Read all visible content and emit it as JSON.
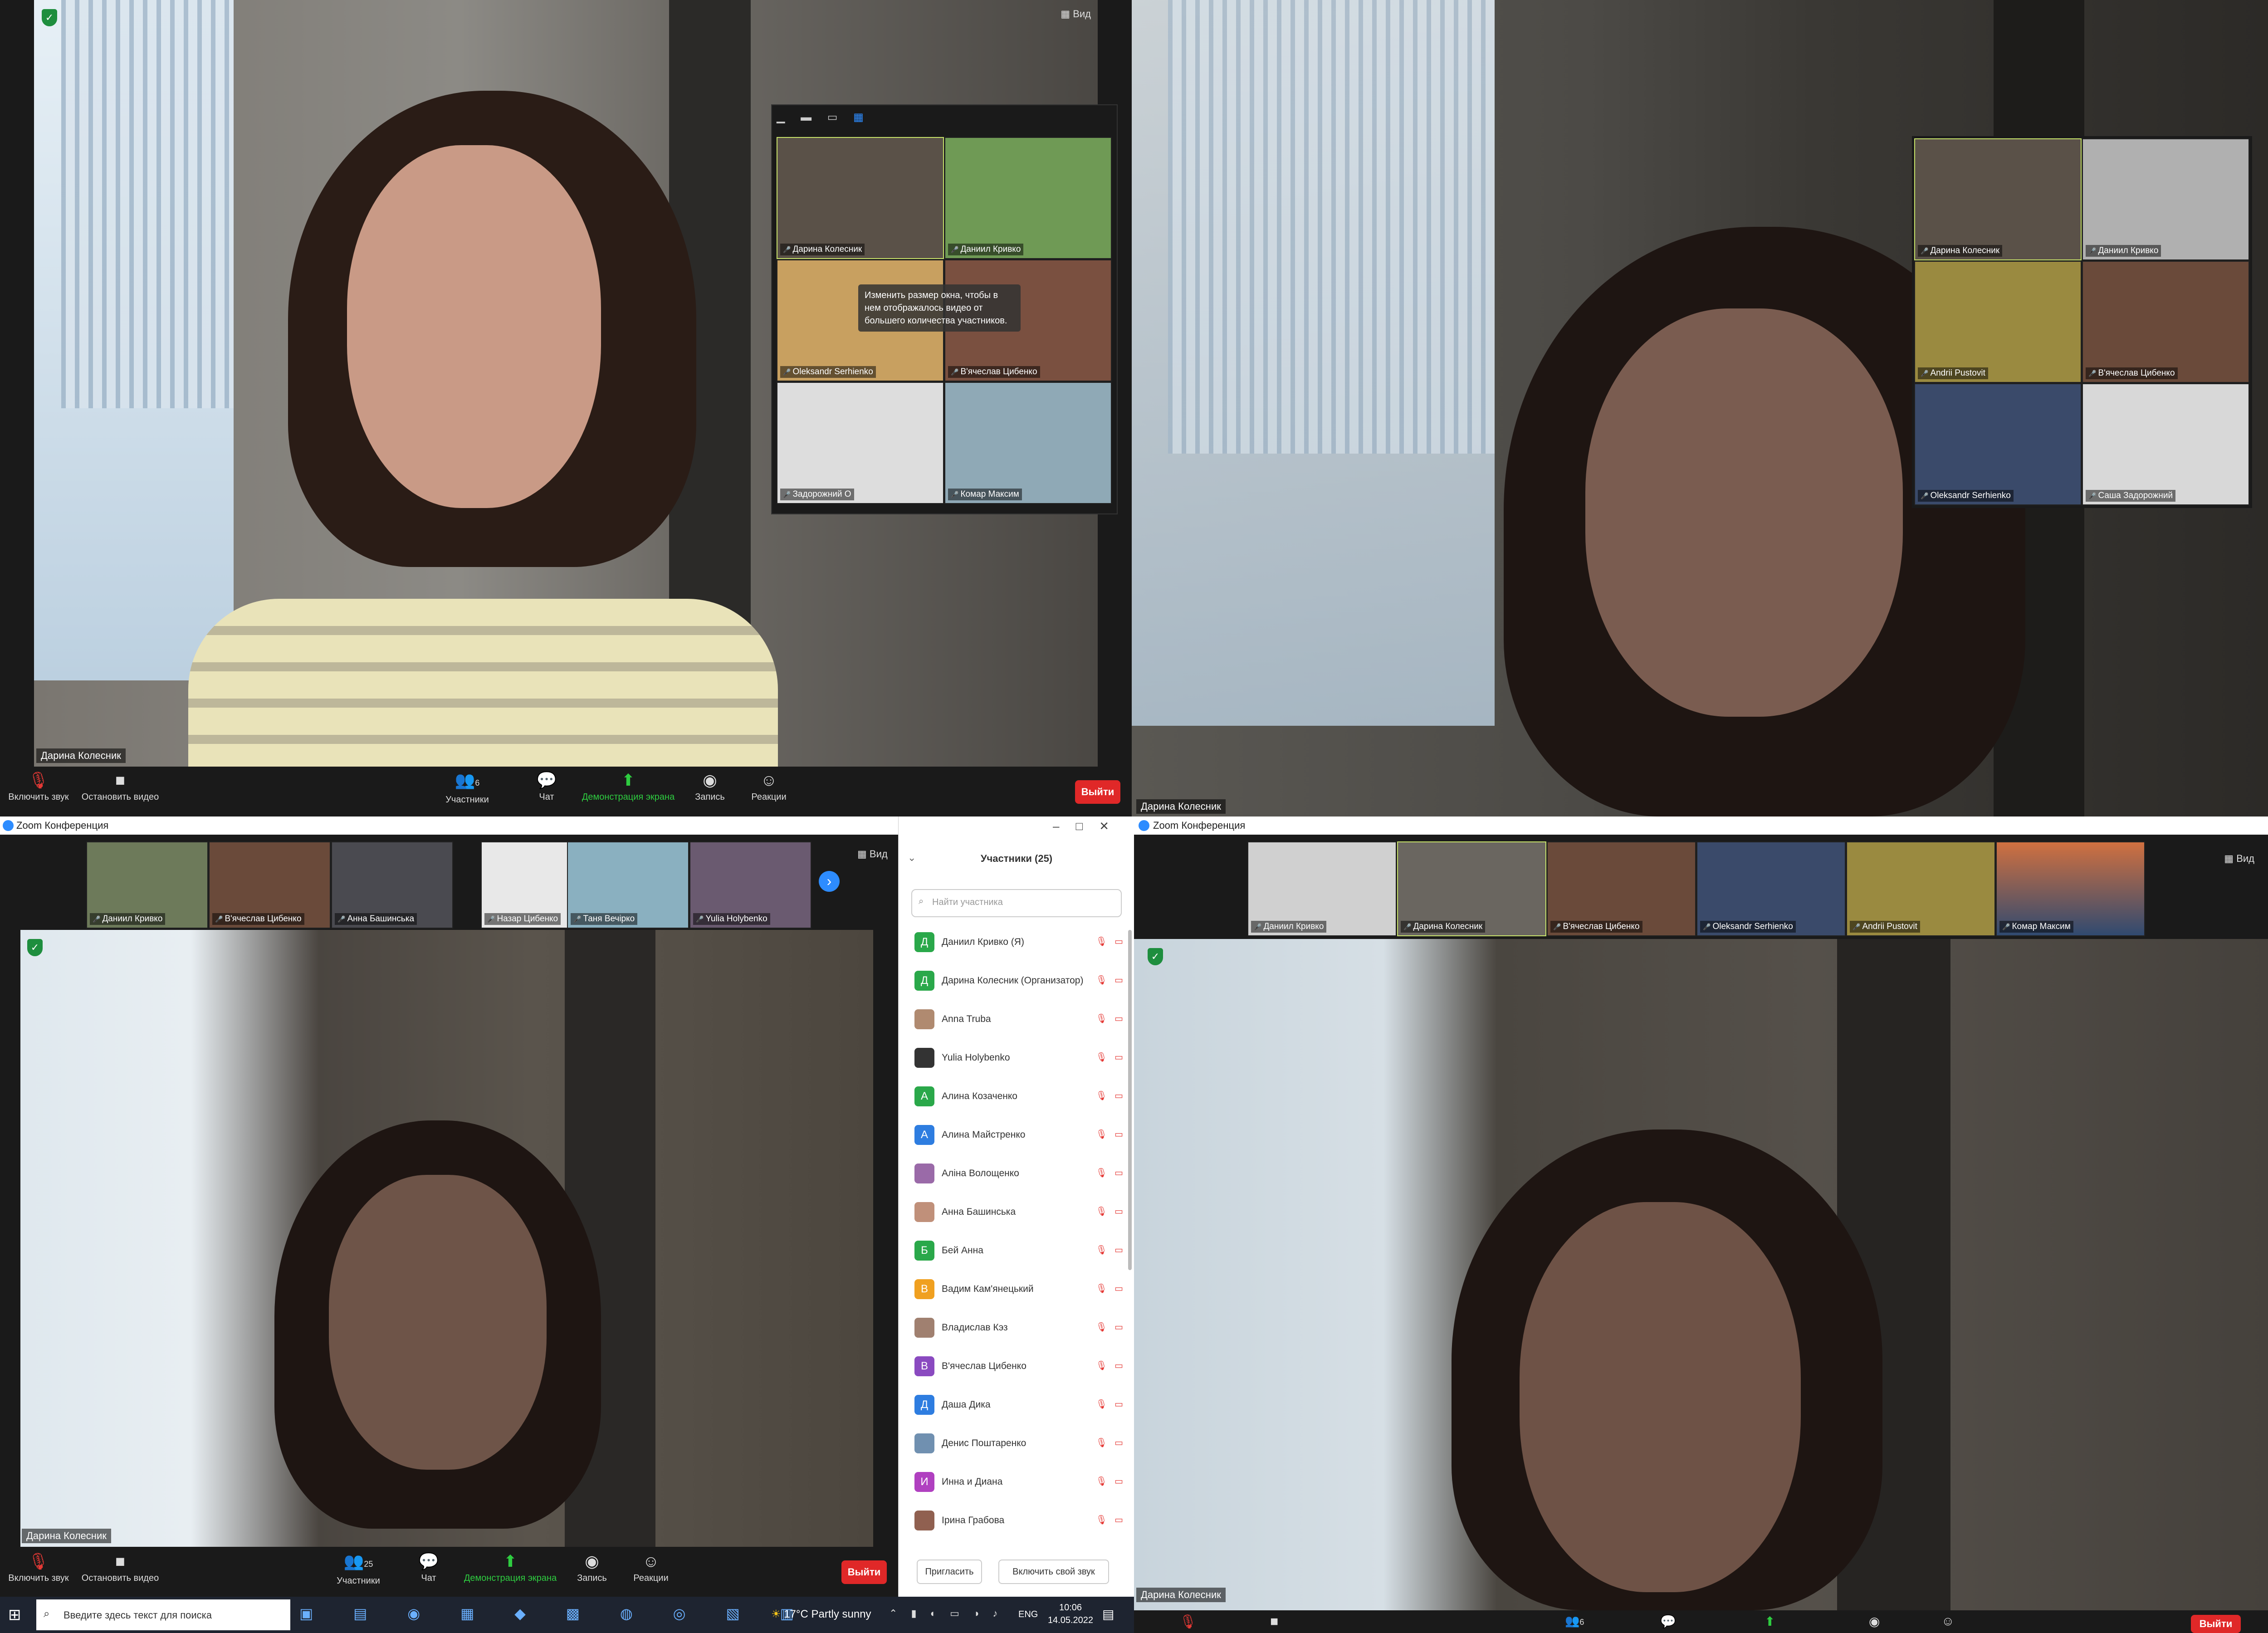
{
  "q1": {
    "view_label": "Вид",
    "main_name": "Дарина Колесник",
    "gallery_tooltip": "Изменить размер окна, чтобы в нем отображалось видео от большего количества участников.",
    "tiles": [
      "Дарина Колесник",
      "Даниил Кривко",
      "Oleksandr Serhienko",
      "В'ячеслав Цибенко",
      "Задорожний О",
      "Комар Максим"
    ],
    "toolbar": {
      "unmute": "Включить звук",
      "stop_video": "Остановить видео",
      "participants": "Участники",
      "participants_count": "6",
      "chat": "Чат",
      "share": "Демонстрация экрана",
      "record": "Запись",
      "reactions": "Реакции",
      "leave": "Выйти"
    }
  },
  "q2": {
    "main_name": "Дарина Колесник",
    "tiles": [
      "Дарина Колесник",
      "Даниил Кривко",
      "Andrii Pustovit",
      "В'ячеслав Цибенко",
      "Oleksandr Serhienko",
      "Саша Задорожний"
    ]
  },
  "q3": {
    "window_title": "Zoom Конференция",
    "view_label": "Вид",
    "strip": [
      "Даниил Кривко",
      "В'ячеслав Цибенко",
      "Анна Башинська",
      "Назар Цибенко",
      "Таня Вечірко",
      "Yulia Holybenko"
    ],
    "main_name": "Дарина Колесник",
    "panel_title": "Участники (25)",
    "search_placeholder": "Найти участника",
    "participants": [
      {
        "initial": "Д",
        "color": "#2aa84a",
        "name": "Даниил Кривко (Я)"
      },
      {
        "initial": "Д",
        "color": "#2aa84a",
        "name": "Дарина Колесник (Организатор)"
      },
      {
        "initial": "",
        "color": "#b08a70",
        "name": "Anna Truba"
      },
      {
        "initial": "",
        "color": "#333333",
        "name": "Yulia Holybenko"
      },
      {
        "initial": "А",
        "color": "#2aa84a",
        "name": "Алина Козаченко"
      },
      {
        "initial": "А",
        "color": "#2e7de0",
        "name": "Алина Майстренко"
      },
      {
        "initial": "",
        "color": "#9a6aa8",
        "name": "Аліна Волощенко"
      },
      {
        "initial": "",
        "color": "#c0907a",
        "name": "Анна Башинська"
      },
      {
        "initial": "Б",
        "color": "#2aa84a",
        "name": "Бей Анна"
      },
      {
        "initial": "В",
        "color": "#f0a020",
        "name": "Вадим Кам'янецький"
      },
      {
        "initial": "",
        "color": "#a08070",
        "name": "Владислав Кэз"
      },
      {
        "initial": "В",
        "color": "#8a4ac0",
        "name": "В'ячеслав Цибенко"
      },
      {
        "initial": "Д",
        "color": "#2e7de0",
        "name": "Даша Дика"
      },
      {
        "initial": "",
        "color": "#7090b0",
        "name": "Денис Поштаренко"
      },
      {
        "initial": "И",
        "color": "#b040c0",
        "name": "Инна и Диана"
      },
      {
        "initial": "",
        "color": "#906050",
        "name": "Ірина Грабова"
      }
    ],
    "invite": "Пригласить",
    "unmute_self": "Включить свой звук",
    "toolbar": {
      "unmute": "Включить звук",
      "stop_video": "Остановить видео",
      "participants": "Участники",
      "participants_count": "25",
      "chat": "Чат",
      "share": "Демонстрация экрана",
      "record": "Запись",
      "reactions": "Реакции",
      "leave": "Выйти"
    },
    "taskbar": {
      "search_placeholder": "Введите здесь текст для поиска",
      "weather": "17°C  Partly sunny",
      "lang": "ENG",
      "time": "10:06",
      "date": "14.05.2022"
    }
  },
  "q4": {
    "window_title": "Zoom Конференция",
    "view_label": "Вид",
    "strip": [
      "Даниил Кривко",
      "Дарина Колесник",
      "В'ячеслав Цибенко",
      "Oleksandr Serhienko",
      "Andrii Pustovit",
      "Комар Максим"
    ],
    "main_name": "Дарина Колесник",
    "participants_count": "6",
    "leave": "Выйти"
  }
}
